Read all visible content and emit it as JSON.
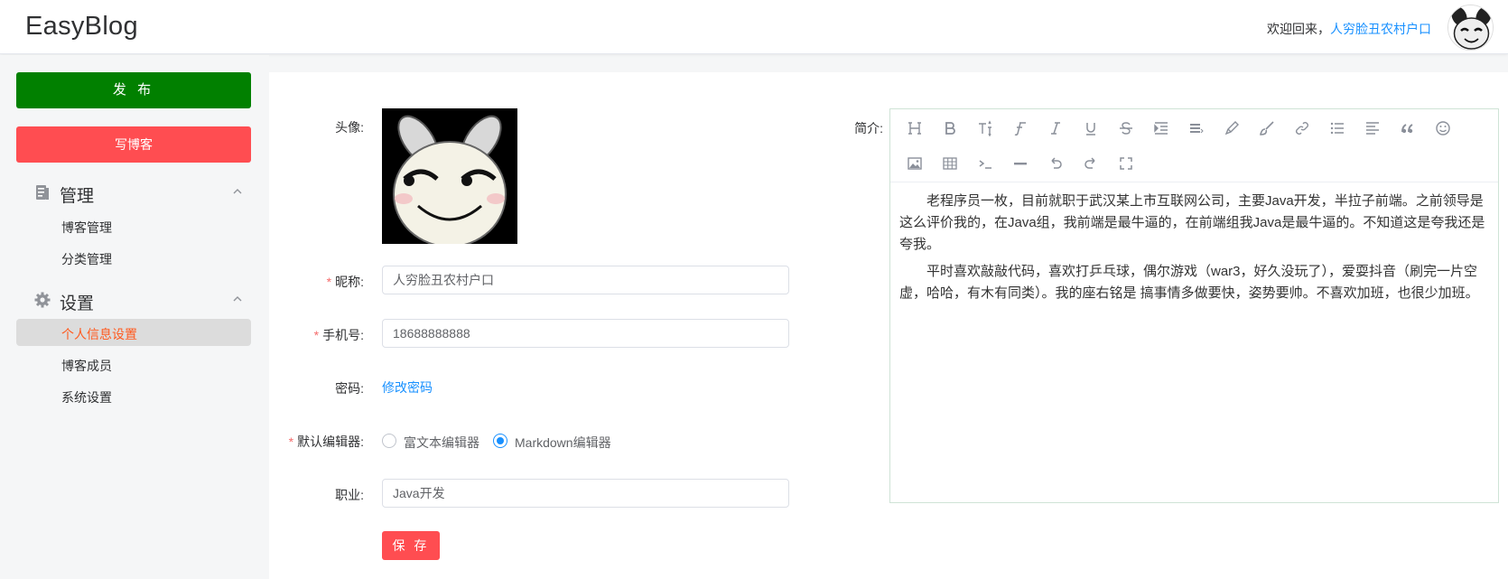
{
  "header": {
    "logo": "EasyBlog",
    "welcome_text": "欢迎回来，",
    "username": "人穷脸丑农村户口"
  },
  "sidebar": {
    "publish_label": "发 布",
    "write_label": "写博客",
    "groups": [
      {
        "label": "管理",
        "icon": "document-icon",
        "items": [
          "博客管理",
          "分类管理"
        ]
      },
      {
        "label": "设置",
        "icon": "gear-icon",
        "items": [
          "个人信息设置",
          "博客成员",
          "系统设置"
        ]
      }
    ],
    "active_item": "个人信息设置"
  },
  "form": {
    "avatar_label": "头像:",
    "nickname_label": "昵称:",
    "nickname_value": "人穷脸丑农村户口",
    "phone_label": "手机号:",
    "phone_value": "18688888888",
    "password_label": "密码:",
    "password_link": "修改密码",
    "editor_label": "默认编辑器:",
    "editor_options": [
      "富文本编辑器",
      "Markdown编辑器"
    ],
    "editor_selected": "Markdown编辑器",
    "job_label": "职业:",
    "job_value": "Java开发",
    "save_label": "保 存",
    "intro_label": "简介:"
  },
  "editor": {
    "toolbar_icons": [
      "heading-icon",
      "bold-icon",
      "text-size-icon",
      "font-icon",
      "italic-icon",
      "underline-icon",
      "strikethrough-icon",
      "indent-icon",
      "align-icon",
      "pen-icon",
      "brush-icon",
      "link-icon",
      "list-icon",
      "justify-icon",
      "quote-icon",
      "emoji-icon",
      "image-icon",
      "table-icon",
      "code-icon",
      "divider-icon",
      "undo-icon",
      "redo-icon",
      "fullscreen-icon"
    ],
    "paragraphs": [
      "老程序员一枚，目前就职于武汉某上市互联网公司，主要Java开发，半拉子前端。之前领导是这么评价我的，在Java组，我前端是最牛逼的，在前端组我Java是最牛逼的。不知道这是夸我还是夸我。",
      "平时喜欢敲敲代码，喜欢打乒乓球，偶尔游戏（war3，好久没玩了），爱耍抖音（刷完一片空虚，哈哈，有木有同类）。我的座右铭是 搞事情多做要快，姿势要帅。不喜欢加班，也很少加班。"
    ]
  },
  "colors": {
    "publish": "#018000",
    "accent_red": "#ff4d51",
    "link_blue": "#1890ff",
    "active_text": "#ff5a1f"
  }
}
